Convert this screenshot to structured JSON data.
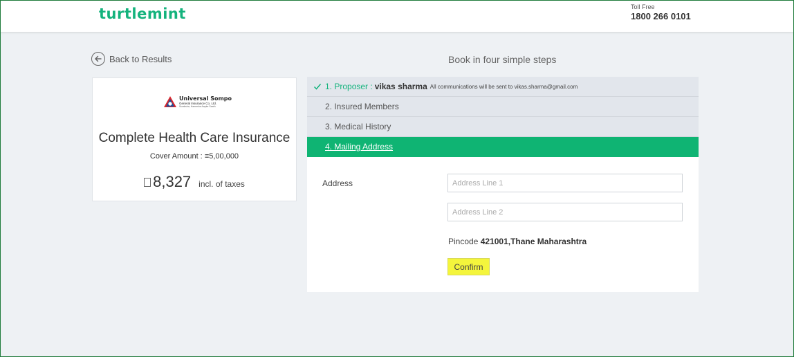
{
  "header": {
    "logo": "turtlemint",
    "toll_free_label": "Toll Free",
    "toll_free_number": "1800 266 0101",
    "brand_color": "#14b37d"
  },
  "nav": {
    "back_label": "Back to Results",
    "steps_title": "Book in four simple steps"
  },
  "product": {
    "insurer_name": "Universal Sompo",
    "insurer_subtitle": "General Insurance Co. Ltd.",
    "insurer_tagline": "Suraksha, Hamesha Aapke Saath",
    "name": "Complete Health Care Insurance",
    "cover_label": "Cover Amount :",
    "cover_amount": "5,00,000",
    "price": "8,327",
    "price_note": "incl. of taxes"
  },
  "steps": [
    {
      "label": "1. Proposer :",
      "name": "vikas sharma",
      "note": "All communications will be sent to vikas.sharma@gmail.com",
      "status": "done"
    },
    {
      "label": "2. Insured Members",
      "status": "pending"
    },
    {
      "label": "3. Medical History",
      "status": "pending"
    },
    {
      "label": "4. Mailing Address",
      "status": "active"
    }
  ],
  "form": {
    "address_label": "Address",
    "line1_placeholder": "Address Line 1",
    "line2_placeholder": "Address Line 2",
    "pincode_label": "Pincode",
    "pincode_value": "421001,Thane Maharashtra",
    "confirm_label": "Confirm"
  },
  "colors": {
    "active_step": "#0fb473",
    "confirm_button": "#f4f53c",
    "page_background": "#eef1f4"
  }
}
